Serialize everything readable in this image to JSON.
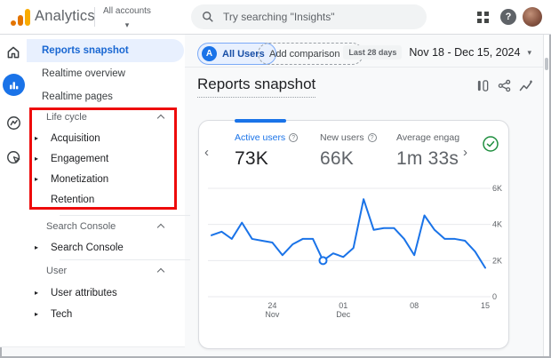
{
  "header": {
    "app_name": "Analytics",
    "account_label": "All accounts",
    "search_placeholder": "Try searching \"Insights\""
  },
  "icons": {
    "caret_down": "▾",
    "triangle_right": "▸",
    "chevron_left": "‹",
    "chevron_right": "›",
    "help": "?",
    "plus": "+",
    "all_users_initial": "A"
  },
  "sidebar": {
    "nav_items": [
      {
        "label": "Reports snapshot",
        "selected": true
      },
      {
        "label": "Realtime overview",
        "selected": false
      },
      {
        "label": "Realtime pages",
        "selected": false
      }
    ],
    "sections": [
      {
        "title": "Life cycle",
        "items": [
          {
            "label": "Acquisition"
          },
          {
            "label": "Engagement"
          },
          {
            "label": "Monetization"
          },
          {
            "label": "Retention"
          }
        ]
      },
      {
        "title": "Search Console",
        "items": [
          {
            "label": "Search Console"
          }
        ]
      },
      {
        "title": "User",
        "items": [
          {
            "label": "User attributes"
          },
          {
            "label": "Tech"
          }
        ]
      }
    ],
    "highlight_color": "#ee0b0b"
  },
  "toolbar": {
    "all_users_label": "All Users",
    "add_comparison_label": "Add comparison",
    "date_preset": "Last 28 days",
    "date_range": "Nov 18 - Dec 15, 2024"
  },
  "page": {
    "title": "Reports snapshot"
  },
  "metrics_card": {
    "metrics": [
      {
        "label": "Active users",
        "value": "73K",
        "selected": true
      },
      {
        "label": "New users",
        "value": "66K",
        "selected": false
      },
      {
        "label": "Average engag",
        "value": "1m 33s",
        "selected": false
      }
    ]
  },
  "chart_data": {
    "type": "line",
    "title": "Active users by day",
    "series_name": "Active users",
    "dates": [
      "Nov 18",
      "Nov 19",
      "Nov 20",
      "Nov 21",
      "Nov 22",
      "Nov 23",
      "Nov 24",
      "Nov 25",
      "Nov 26",
      "Nov 27",
      "Nov 28",
      "Nov 29",
      "Nov 30",
      "Dec 1",
      "Dec 2",
      "Dec 3",
      "Dec 4",
      "Dec 5",
      "Dec 6",
      "Dec 7",
      "Dec 8",
      "Dec 9",
      "Dec 10",
      "Dec 11",
      "Dec 12",
      "Dec 13",
      "Dec 14",
      "Dec 15"
    ],
    "values": [
      3400,
      3600,
      3200,
      4100,
      3200,
      3100,
      3000,
      2300,
      2900,
      3200,
      3200,
      2000,
      2400,
      2200,
      2700,
      5400,
      3700,
      3800,
      3800,
      3200,
      2300,
      4500,
      3700,
      3200,
      3200,
      3100,
      2500,
      1600
    ],
    "marker_index": 11,
    "ylim": [
      0,
      6000
    ],
    "y_ticks": [
      {
        "value": 0,
        "label": "0"
      },
      {
        "value": 2000,
        "label": "2K"
      },
      {
        "value": 4000,
        "label": "4K"
      },
      {
        "value": 6000,
        "label": "6K"
      }
    ],
    "x_ticks": [
      {
        "i": 6,
        "top": "24",
        "bottom": "Nov"
      },
      {
        "i": 13,
        "top": "01",
        "bottom": "Dec"
      },
      {
        "i": 20,
        "top": "08",
        "bottom": ""
      },
      {
        "i": 27,
        "top": "15",
        "bottom": ""
      }
    ],
    "grid": true,
    "legend": "none",
    "line_color": "#1a73e8",
    "grid_color": "#e8eaed",
    "tick_color": "#5f6368"
  }
}
